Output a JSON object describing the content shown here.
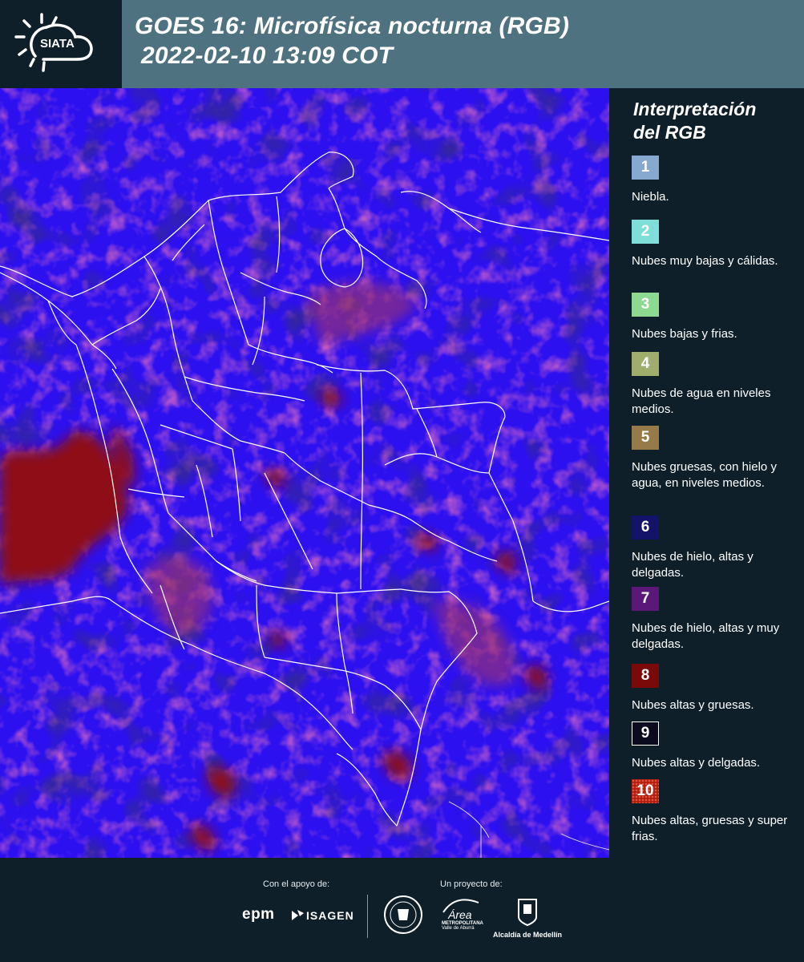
{
  "header": {
    "logo_text": "SIATA",
    "title_line1": "GOES 16: Microfísica nocturna (RGB)",
    "title_line2": "2022-02-10 13:09 COT"
  },
  "map": {
    "base_color": "#2c10f0",
    "high_thick_cloud_color": "#8e0c14",
    "thin_cloud_color": "#0b0830",
    "boundary_color": "#ffffff"
  },
  "legend": {
    "title_line1": "Interpretación",
    "title_line2": "del RGB",
    "items": [
      {
        "num": "1",
        "color": "#87a9cf",
        "label": "Niebla."
      },
      {
        "num": "2",
        "color": "#7fded8",
        "label": "Nubes muy bajas y cálidas."
      },
      {
        "num": "3",
        "color": "#8cd98f",
        "label": "Nubes bajas y frias."
      },
      {
        "num": "4",
        "color": "#9fae6d",
        "label": "Nubes de agua en niveles medios."
      },
      {
        "num": "5",
        "color": "#967a4a",
        "label": "Nubes gruesas, con hielo y agua, en niveles medios."
      },
      {
        "num": "6",
        "color": "#13136a",
        "label": "Nubes de hielo, altas y delgadas."
      },
      {
        "num": "7",
        "color": "#5c1878",
        "label": "Nubes de hielo, altas y muy delgadas."
      },
      {
        "num": "8",
        "color": "#7a0a0a",
        "label": "Nubes altas y gruesas."
      },
      {
        "num": "9",
        "color": "#0b0b20",
        "label": "Nubes altas y delgadas."
      },
      {
        "num": "10",
        "color": "#b21d12",
        "label": "Nubes altas, gruesas y super frias."
      }
    ]
  },
  "footer": {
    "support_label": "Con el apoyo de:",
    "project_label": "Un proyecto de:",
    "epm": "epm",
    "isagen": "ISAGEN",
    "area_line1": "Área",
    "area_line2": "METROPOLITANA",
    "area_line3": "Valle de Aburrá",
    "medellin": "Alcaldía de Medellín"
  }
}
